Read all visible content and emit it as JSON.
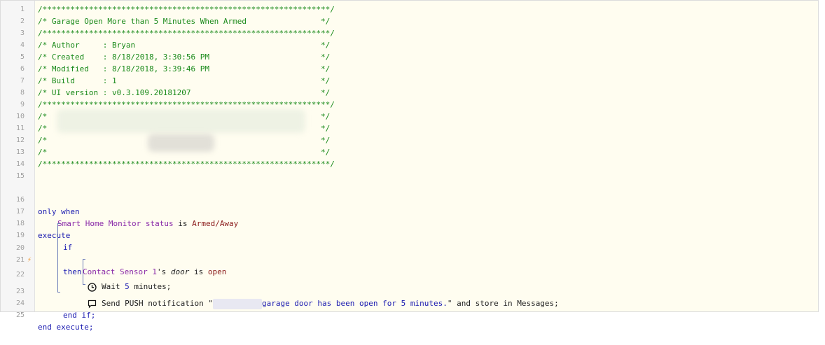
{
  "lines": [
    {
      "n": "1",
      "text": "/**************************************************************/"
    },
    {
      "n": "2",
      "text": "/* Garage Open More than 5 Minutes When Armed                */"
    },
    {
      "n": "3",
      "text": "/**************************************************************/"
    },
    {
      "n": "4",
      "text": "/* Author     : Bryan                                        */"
    },
    {
      "n": "5",
      "text": "/* Created    : 8/18/2018, 3:30:56 PM                        */"
    },
    {
      "n": "6",
      "text": "/* Modified   : 8/18/2018, 3:39:46 PM                        */"
    },
    {
      "n": "7",
      "text": "/* Build      : 1                                            */"
    },
    {
      "n": "8",
      "text": "/* UI version : v0.3.109.20181207                            */"
    },
    {
      "n": "9",
      "text": "/**************************************************************/"
    },
    {
      "n": "10",
      "text": "/*                                                           */"
    },
    {
      "n": "11",
      "text": "/*                                                           */"
    },
    {
      "n": "12",
      "text": "/*                                                           */"
    },
    {
      "n": "13",
      "text": "/*                                                           */"
    },
    {
      "n": "14",
      "text": "/**************************************************************/"
    },
    {
      "n": "15",
      "text": ""
    }
  ],
  "code": {
    "ln16": "16",
    "only_when": "only when",
    "ln17": "17",
    "shm": "Smart Home Monitor status",
    "is1": " is ",
    "armed": "Armed/Away",
    "ln18": "18",
    "execute": "execute",
    "ln19": "19",
    "if": "if",
    "ln20": "20",
    "sensor": "Contact Sensor 1",
    "apos": "'s ",
    "door": "door",
    "is2": " is ",
    "open": "open",
    "ln21": "21",
    "then": "then",
    "ln22": "22",
    "wait": "Wait ",
    "wait_num": "5",
    "wait_unit": " minutes;",
    "ln23": "23",
    "send": "Send PUSH notification \"",
    "msg": "garage door has been open for 5 minutes.",
    "send_tail": "\" and store in Messages;",
    "ln24": "24",
    "end_if": "end if;",
    "ln25": "25",
    "end_execute": "end execute;"
  },
  "marker": "⚡",
  "icons": {
    "wait": "clock-icon",
    "send": "speech-bubble-icon"
  }
}
